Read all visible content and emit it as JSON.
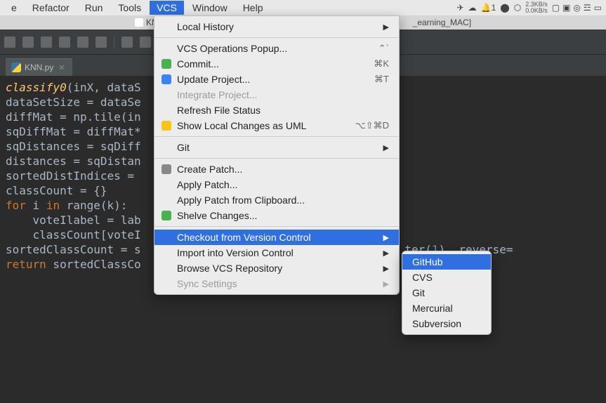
{
  "menubar": {
    "items": [
      "e",
      "Refactor",
      "Run",
      "Tools",
      "VCS",
      "Window",
      "Help"
    ],
    "net_up": "2.3KB/s",
    "net_down": "0.0KB/s"
  },
  "window": {
    "title_prefix": "KNN.py –",
    "title_suffix": "_earning_MAC]"
  },
  "tab": {
    "filename": "KNN.py"
  },
  "code": {
    "l1_a": "classify0",
    "l1_b": "(inX, dataS",
    "l2": "dataSetSize = dataSe",
    "l3": "diffMat = np.tile(in",
    "l4": "sqDiffMat = diffMat*",
    "l5": "sqDistances = sqDiff",
    "l6": "distances = sqDistan",
    "l7": "sortedDistIndices = ",
    "l8_a": "classCount = {}",
    "l9_a": "for",
    "l9_b": " i ",
    "l9_c": "in",
    "l9_d": " range(k):",
    "l10": "    voteIlabel = lab",
    "l11": "    classCount[voteI",
    "l12_a": "sortedClassCount = s",
    "l12_b": "ter(",
    "l12_c": "1",
    "l12_d": "), reverse=",
    "l13_a": "return",
    "l13_b": " sortedClassCo"
  },
  "vcsMenu": {
    "localHistory": "Local History",
    "vcsOpsPopup": "VCS Operations Popup...",
    "vcsOpsShortcut": "⌃`",
    "commit": "Commit...",
    "commitShortcut": "⌘K",
    "updateProject": "Update Project...",
    "updateShortcut": "⌘T",
    "integrateProject": "Integrate Project...",
    "refreshFile": "Refresh File Status",
    "showLocalUML": "Show Local Changes as UML",
    "showLocalShortcut": "⌥⇧⌘D",
    "git": "Git",
    "createPatch": "Create Patch...",
    "applyPatch": "Apply Patch...",
    "applyClipboard": "Apply Patch from Clipboard...",
    "shelve": "Shelve Changes...",
    "checkout": "Checkout from Version Control",
    "importInto": "Import into Version Control",
    "browseRepo": "Browse VCS Repository",
    "syncSettings": "Sync Settings"
  },
  "submenu": {
    "github": "GitHub",
    "cvs": "CVS",
    "gitItem": "Git",
    "mercurial": "Mercurial",
    "subversion": "Subversion"
  }
}
